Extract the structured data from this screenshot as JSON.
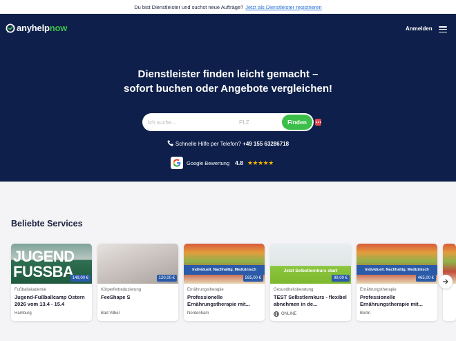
{
  "topbar": {
    "text": "Du bist Dienstleister und suchst neue Aufträge?",
    "link": "Jetzt als Dienstleister registrieren"
  },
  "nav": {
    "logo_main": "anyhelp",
    "logo_accent": "now",
    "login_label": "Anmelden",
    "menu_icon": "hamburger-icon"
  },
  "hero": {
    "headline_line1": "Dienstleister finden leicht gemacht –",
    "headline_line2": "sofort buchen oder Angebote vergleichen!",
    "search_placeholder": "Ich suche...",
    "plz_placeholder": "PLZ",
    "search_button": "Finden",
    "phone_label": "Schnelle Hilfe per Telefon?",
    "phone_number": "+49 155 63286718",
    "rating_label": "Google Bewertung",
    "rating_score": "4.8",
    "rating_stars": "★★★★★"
  },
  "services": {
    "title": "Beliebte Services",
    "cards": [
      {
        "category": "Fußballakademie",
        "title": "Jugend-Fußballcamp Ostern 2026 vom 13.4 - 15.4",
        "price": "149,00 €",
        "location": "Hamburg",
        "image_text": "JUGEND FUSSBA",
        "banner": ""
      },
      {
        "category": "Körperfettreduzierung",
        "title": "FeeShape S",
        "price": "120,00 €",
        "location": "Bad Vilbel",
        "image_text": "",
        "banner": ""
      },
      {
        "category": "Ernährungstherapie",
        "title": "Professionelle Ernährungstherapie mit...",
        "price": "595,00 €",
        "location": "Nordenham",
        "image_text": "",
        "banner": "Individuell. Nachhaltig. Medizinisch"
      },
      {
        "category": "Gesundheitsberatung",
        "title": "TEST Selbstlernkurs - flexibel abnehmen in de...",
        "price": "99,00 €",
        "location": "ONLINE",
        "image_text": "Jetzt Selbstlernkurs start",
        "banner": ""
      },
      {
        "category": "Ernährungstherapie",
        "title": "Professionelle Ernährungstherapie mit...",
        "price": "465,00 €",
        "location": "Berlin",
        "image_text": "",
        "banner": "Individuell. Nachhaltig. Medizinisch"
      }
    ],
    "next_icon": "chevron-right-icon"
  },
  "colors": {
    "hero_bg": "#0d1f4a",
    "accent_green": "#3bbf4a",
    "price_blue": "#2a5aa8",
    "link_blue": "#2a6fd6"
  }
}
